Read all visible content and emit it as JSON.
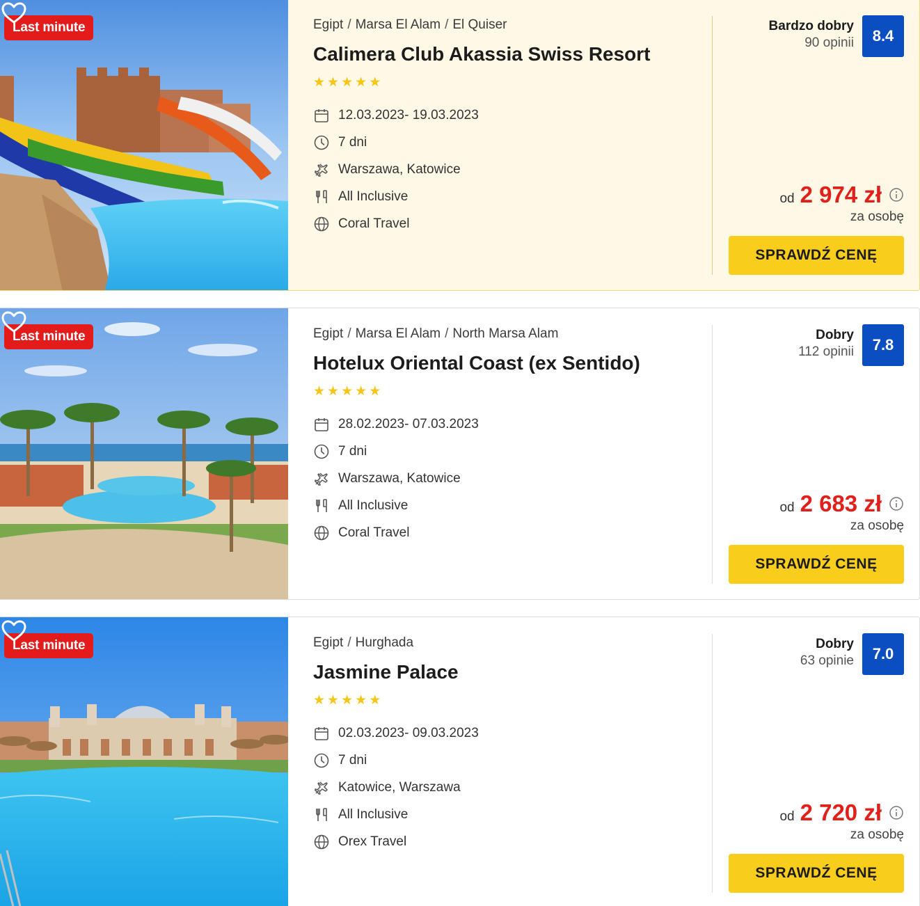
{
  "offers": [
    {
      "badge": "Last minute",
      "photo_subject": "aquapark water slides",
      "breadcrumb": [
        "Egipt",
        "Marsa El Alam",
        "El Quiser"
      ],
      "name": "Calimera Club Akassia Swiss Resort",
      "stars": 5,
      "dates": "12.03.2023- 19.03.2023",
      "duration": "7 dni",
      "departure": "Warszawa, Katowice",
      "board": "All Inclusive",
      "operator": "Coral Travel",
      "rating_label": "Bardzo dobry",
      "rating_count": "90 opinii",
      "rating_score": "8.4",
      "price_from": "od",
      "price": "2 974 zł",
      "per_person": "za osobę",
      "cta": "SPRAWDŹ CENĘ",
      "highlighted": true
    },
    {
      "badge": "Last minute",
      "photo_subject": "palm trees and pool by the sea",
      "breadcrumb": [
        "Egipt",
        "Marsa El Alam",
        "North Marsa Alam"
      ],
      "name": "Hotelux Oriental Coast (ex Sentido)",
      "stars": 5,
      "dates": "28.02.2023- 07.03.2023",
      "duration": "7 dni",
      "departure": "Warszawa, Katowice",
      "board": "All Inclusive",
      "operator": "Coral Travel",
      "rating_label": "Dobry",
      "rating_count": "112 opinii",
      "rating_score": "7.8",
      "price_from": "od",
      "price": "2 683 zł",
      "per_person": "za osobę",
      "cta": "SPRAWDŹ CENĘ",
      "highlighted": false
    },
    {
      "badge": "Last minute",
      "photo_subject": "palace hotel with large pool",
      "breadcrumb": [
        "Egipt",
        "Hurghada"
      ],
      "name": "Jasmine Palace",
      "stars": 5,
      "dates": "02.03.2023- 09.03.2023",
      "duration": "7 dni",
      "departure": "Katowice, Warszawa",
      "board": "All Inclusive",
      "operator": "Orex Travel",
      "rating_label": "Dobry",
      "rating_count": "63 opinie",
      "rating_score": "7.0",
      "price_from": "od",
      "price": "2 720 zł",
      "per_person": "za osobę",
      "cta": "SPRAWDŹ CENĘ",
      "highlighted": false
    }
  ],
  "colors": {
    "badge": "#e31b1b",
    "score": "#0a4ec2",
    "price": "#e0201b",
    "cta": "#f9cd1b",
    "highlight_bg": "#fef8e6",
    "star": "#f5c518"
  },
  "icons": {
    "dates": "calendar-icon",
    "duration": "clock-icon",
    "departure": "plane-icon",
    "board": "cutlery-icon",
    "operator": "globe-icon",
    "favorite": "heart-icon",
    "price_info": "info-icon"
  }
}
